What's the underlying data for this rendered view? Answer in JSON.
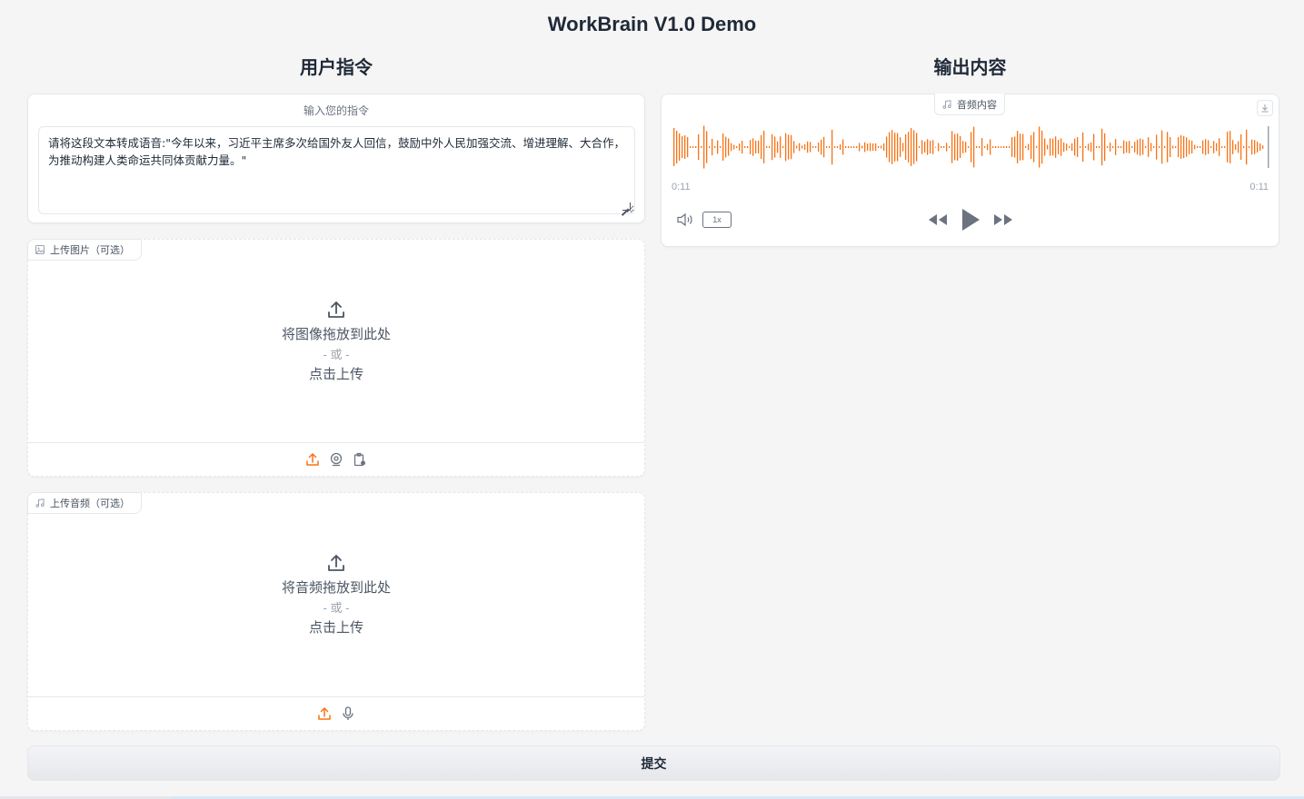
{
  "app": {
    "title": "WorkBrain V1.0 Demo"
  },
  "left": {
    "title": "用户指令",
    "instruction": {
      "label": "输入您的指令",
      "value": "请将这段文本转成语音:\"今年以来，习近平主席多次给国外友人回信，鼓励中外人民加强交流、增进理解、大合作，为推动构建人类命运共同体贡献力量。\""
    },
    "image_upload": {
      "tag": "上传图片（可选）",
      "drop_text": "将图像拖放到此处",
      "or_text": "- 或 -",
      "click_text": "点击上传",
      "sources": [
        "upload-icon",
        "webcam-icon",
        "clipboard-icon"
      ]
    },
    "audio_upload": {
      "tag": "上传音频（可选）",
      "drop_text": "将音频拖放到此处",
      "or_text": "- 或 -",
      "click_text": "点击上传",
      "sources": [
        "upload-icon",
        "microphone-icon"
      ]
    }
  },
  "right": {
    "title": "输出内容",
    "audio_output": {
      "tag": "音频内容",
      "current_time": "0:11",
      "duration": "0:11",
      "speed": "1x",
      "waveform_color": "#f97316"
    }
  },
  "submit": {
    "label": "提交"
  },
  "colors": {
    "accent": "#f97316",
    "background": "#f5f5f5"
  }
}
